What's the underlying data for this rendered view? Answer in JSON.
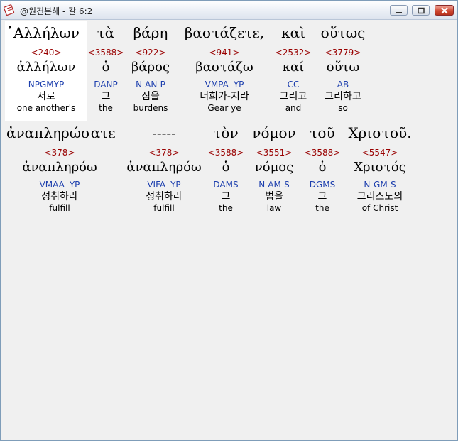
{
  "window": {
    "title": "@원견본해 - 갈 6:2",
    "minimize_icon": "minimize-icon",
    "maximize_icon": "maximize-icon",
    "close_icon": "close-icon",
    "app_icon": "bible-app-icon"
  },
  "line1": [
    {
      "greek": "᾽Αλλήλων",
      "strong": "<240>",
      "lemma": "ἀλλήλων",
      "parse": "NPGMYP",
      "korean": "서로",
      "english": "one another's"
    },
    {
      "greek": "τὰ",
      "strong": "<3588>",
      "lemma": "ὁ",
      "parse": "DANP",
      "korean": "그",
      "english": "the"
    },
    {
      "greek": "βάρη",
      "strong": "<922>",
      "lemma": "βάρος",
      "parse": "N-AN-P",
      "korean": "짐을",
      "english": "burdens"
    },
    {
      "greek": "βαστάζετε,",
      "strong": "<941>",
      "lemma": "βαστάζω",
      "parse": "VMPA--YP",
      "korean": "너희가-지라",
      "english": "Gear ye"
    },
    {
      "greek": "καὶ",
      "strong": "<2532>",
      "lemma": "καί",
      "parse": "CC",
      "korean": "그리고",
      "english": "and"
    },
    {
      "greek": "οὕτως",
      "strong": "<3779>",
      "lemma": "οὕτω",
      "parse": "AB",
      "korean": "그리하고",
      "english": "so"
    }
  ],
  "line2": [
    {
      "greek": "ἀναπληρώσατε",
      "strong": "<378>",
      "lemma": "ἀναπληρόω",
      "parse": "VMAA--YP",
      "korean": "성취하라",
      "english": "fulfill"
    },
    {
      "greek": "-----",
      "strong": "<378>",
      "lemma": "ἀναπληρόω",
      "parse": "VIFA--YP",
      "korean": "성취하라",
      "english": "fulfill"
    },
    {
      "greek": "τὸν",
      "strong": "<3588>",
      "lemma": "ὁ",
      "parse": "DAMS",
      "korean": "그",
      "english": "the"
    },
    {
      "greek": "νόμον",
      "strong": "<3551>",
      "lemma": "νόμος",
      "parse": "N-AM-S",
      "korean": "법을",
      "english": "law"
    },
    {
      "greek": "τοῦ",
      "strong": "<3588>",
      "lemma": "ὁ",
      "parse": "DGMS",
      "korean": "그",
      "english": "the"
    },
    {
      "greek": "Χριστοῦ.",
      "strong": "<5547>",
      "lemma": "Χριστός",
      "parse": "N-GM-S",
      "korean": "그리스도의",
      "english": "of Christ"
    }
  ],
  "colors": {
    "strong_number": "#990000",
    "parsing": "#1d3fae",
    "selected_word_bg": "#ffffff"
  }
}
